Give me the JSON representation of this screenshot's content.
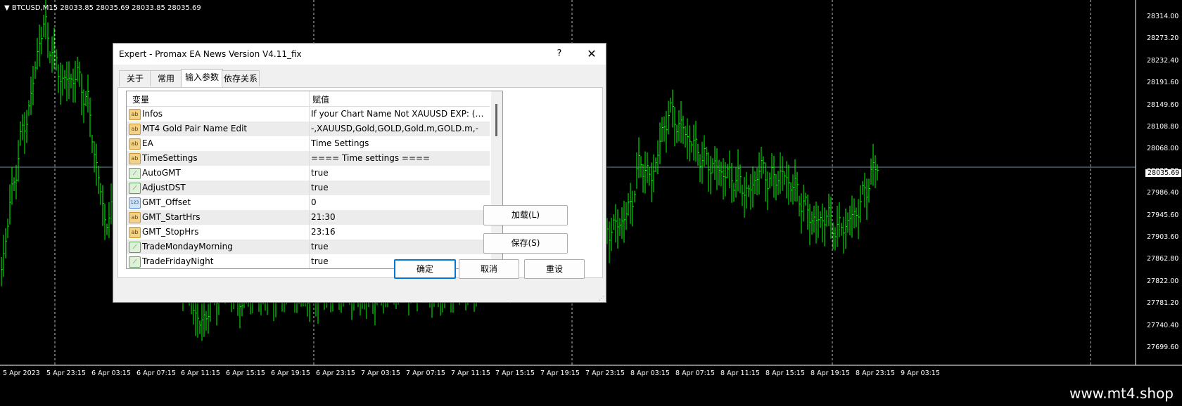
{
  "chart": {
    "header": "BTCUSD,M15  28033.85 28035.69 28033.85 28035.69",
    "current_price": "28035.69",
    "price_labels": [
      "28314.00",
      "28273.20",
      "28232.40",
      "28191.60",
      "28149.60",
      "28108.80",
      "28068.00",
      "28027.20",
      "27986.40",
      "27945.60",
      "27903.60",
      "27862.80",
      "27822.00",
      "27781.20",
      "27740.40",
      "27699.60"
    ],
    "time_labels": [
      "5 Apr 2023",
      "5 Apr 23:15",
      "6 Apr 03:15",
      "6 Apr 07:15",
      "6 Apr 11:15",
      "6 Apr 15:15",
      "6 Apr 19:15",
      "6 Apr 23:15",
      "7 Apr 03:15",
      "7 Apr 07:15",
      "7 Apr 11:15",
      "7 Apr 15:15",
      "7 Apr 19:15",
      "7 Apr 23:15",
      "8 Apr 03:15",
      "8 Apr 07:15",
      "8 Apr 11:15",
      "8 Apr 15:15",
      "8 Apr 19:15",
      "8 Apr 23:15",
      "9 Apr 03:15"
    ],
    "candle_color": "#00ff00",
    "background": "#000000"
  },
  "dialog": {
    "title": "Expert - Promax EA News Version V4.11_fix",
    "help": "?",
    "close": "✕",
    "tabs": [
      {
        "label": "关于"
      },
      {
        "label": "常用"
      },
      {
        "label": "输入参数"
      },
      {
        "label": "依存关系"
      }
    ],
    "grid": {
      "col_variable": "变量",
      "col_value": "赋值",
      "rows": [
        {
          "icon": "ab",
          "name": "Infos",
          "value": "If your Chart Name Not XAUUSD EXP: (XAUUSD.m...)"
        },
        {
          "icon": "ab",
          "name": "MT4 Gold Pair Name Edit",
          "value": "-,XAUUSD,Gold,GOLD,Gold.m,GOLD.m,-"
        },
        {
          "icon": "ab",
          "name": "EA",
          "value": "Time Settings"
        },
        {
          "icon": "ab",
          "name": "TimeSettings",
          "value": "==== Time settings ===="
        },
        {
          "icon": "bool",
          "name": "AutoGMT",
          "value": "true"
        },
        {
          "icon": "bool",
          "name": "AdjustDST",
          "value": "true"
        },
        {
          "icon": "num",
          "name": "GMT_Offset",
          "value": "0"
        },
        {
          "icon": "ab",
          "name": "GMT_StartHrs",
          "value": "21:30"
        },
        {
          "icon": "ab",
          "name": "GMT_StopHrs",
          "value": "23:16"
        },
        {
          "icon": "bool",
          "name": "TradeMondayMorning",
          "value": "true"
        },
        {
          "icon": "bool",
          "name": "TradeFridayNight",
          "value": "true"
        }
      ]
    },
    "load_button": "加载(L)",
    "save_button": "保存(S)",
    "ok_button": "确定",
    "cancel_button": "取消",
    "reset_button": "重设"
  },
  "watermark": "www.mt4.shop"
}
